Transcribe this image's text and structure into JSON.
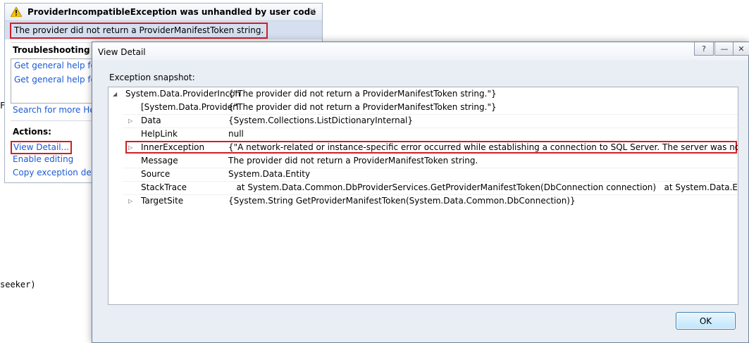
{
  "background": {
    "code_fragment_1": "F",
    "code_fragment_2": "seeker)"
  },
  "assistant": {
    "title": "ProviderIncompatibleException was unhandled by user code",
    "close": "×",
    "message": "The provider did not return a ProviderManifestToken string.",
    "troubleshooting_title": "Troubleshooting tips",
    "tips": [
      "Get general help for e",
      "Get general help for t"
    ],
    "search_link": "Search for more Help",
    "actions_title": "Actions:",
    "actions": [
      "View Detail...",
      "Enable editing",
      "Copy exception detai"
    ]
  },
  "dialog": {
    "title": "View Detail",
    "help_btn": "?",
    "minimize_btn": "—",
    "close_btn": "✕",
    "snapshot_label": "Exception snapshot:",
    "rows": [
      {
        "key": "System.Data.ProviderIncon",
        "value": "{\"The provider did not return a ProviderManifestToken string.\"}"
      },
      {
        "key": "[System.Data.ProviderI",
        "value": "{\"The provider did not return a ProviderManifestToken string.\"}"
      },
      {
        "key": "Data",
        "value": "{System.Collections.ListDictionaryInternal}"
      },
      {
        "key": "HelpLink",
        "value": "null"
      },
      {
        "key": "InnerException",
        "value": "{\"A network-related or instance-specific error occurred while establishing a connection to SQL Server. The server was not found or was no"
      },
      {
        "key": "Message",
        "value": "The provider did not return a ProviderManifestToken string."
      },
      {
        "key": "Source",
        "value": "System.Data.Entity"
      },
      {
        "key": "StackTrace",
        "value": "   at System.Data.Common.DbProviderServices.GetProviderManifestToken(DbConnection connection)   at System.Data.Entity.ModelConf"
      },
      {
        "key": "TargetSite",
        "value": "{System.String GetProviderManifestToken(System.Data.Common.DbConnection)}"
      }
    ],
    "ok_label": "OK"
  },
  "colors": {
    "highlight": "#d01f26",
    "link": "#1c5ad6",
    "message_band": "#d6dff0"
  }
}
